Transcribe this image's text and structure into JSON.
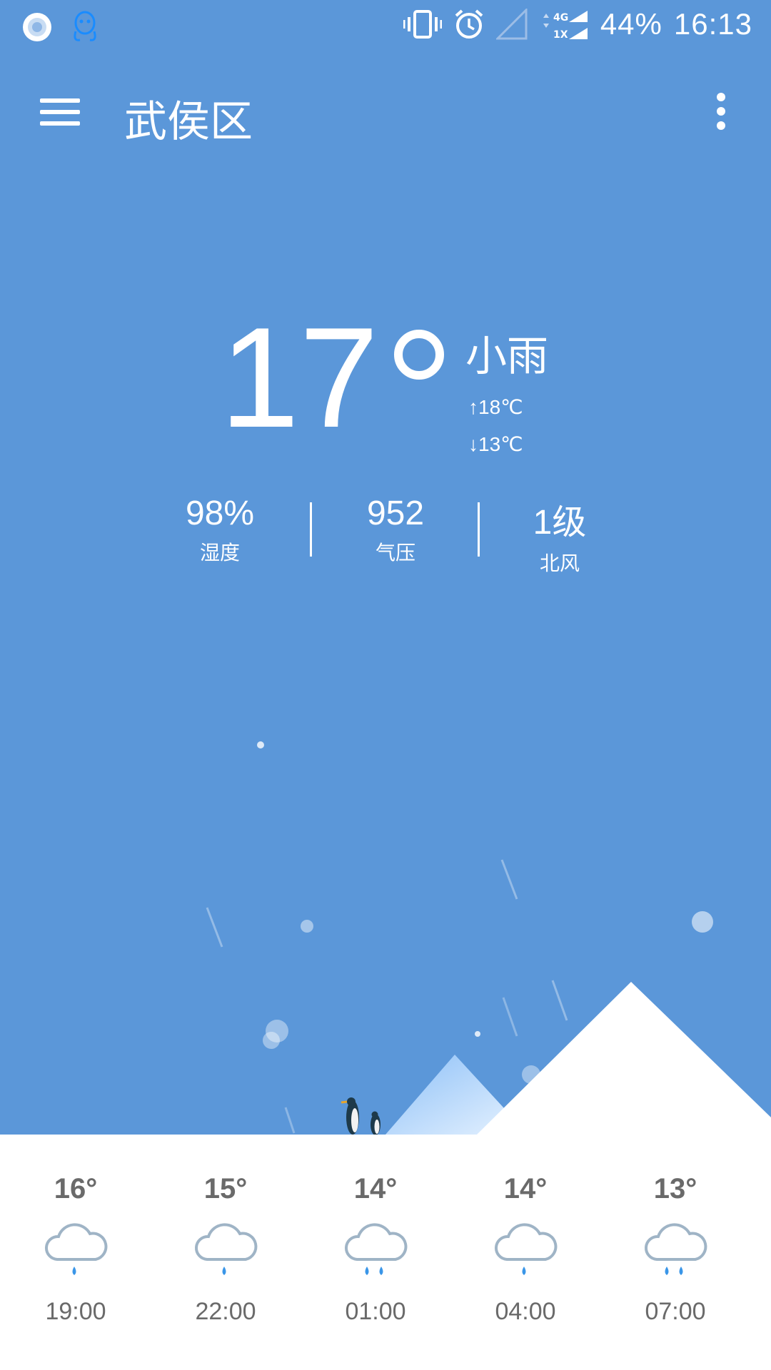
{
  "status_bar": {
    "battery": "44%",
    "time": "16:13",
    "network_top": "4G",
    "network_bottom": "1X"
  },
  "app_bar": {
    "title": "武侯区"
  },
  "current": {
    "temperature": "17",
    "condition": "小雨",
    "high": "↑18℃",
    "low": "↓13℃"
  },
  "stats": [
    {
      "value": "98%",
      "label": "湿度"
    },
    {
      "value": "952",
      "label": "气压"
    },
    {
      "value": "1级",
      "label": "北风"
    }
  ],
  "forecast": [
    {
      "temp": "16°",
      "time": "19:00",
      "icon": "light-rain-icon"
    },
    {
      "temp": "15°",
      "time": "22:00",
      "icon": "light-rain-icon"
    },
    {
      "temp": "14°",
      "time": "01:00",
      "icon": "moderate-rain-icon"
    },
    {
      "temp": "14°",
      "time": "04:00",
      "icon": "light-rain-icon"
    },
    {
      "temp": "13°",
      "time": "07:00",
      "icon": "moderate-rain-icon"
    }
  ],
  "colors": {
    "background": "#5b97d9",
    "forecast_bg": "#ffffff",
    "rain_drop": "#3a96e8",
    "cloud": "#9fb4c6"
  }
}
